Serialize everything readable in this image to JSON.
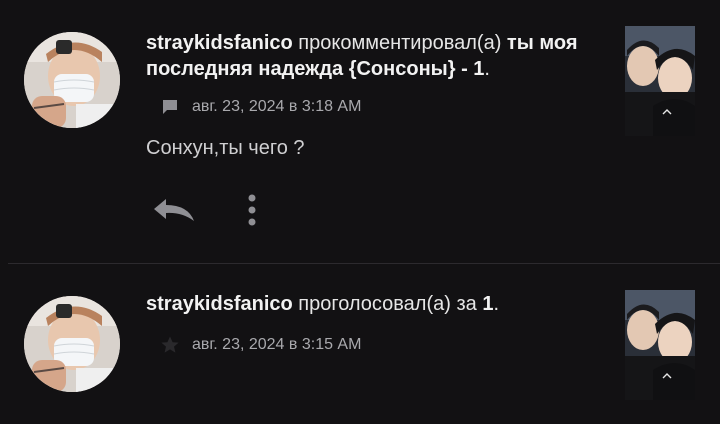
{
  "notifications": [
    {
      "user": "straykidsfanico",
      "action": "прокомментировал(а)",
      "target": "ты моя последняя надежда {Сонсоны} - 1",
      "target_suffix": ".",
      "timestamp": "авг. 23, 2024 в 3:18 AM",
      "meta_icon": "comment-icon",
      "comment": "Сонхун,ты чего ?",
      "actions": [
        {
          "name": "reply",
          "icon": "reply-icon"
        },
        {
          "name": "more",
          "icon": "more-vertical-icon"
        }
      ]
    },
    {
      "user": "straykidsfanico",
      "action": "проголосовал(а) за",
      "target": "1",
      "target_suffix": ".",
      "timestamp": "авг. 23, 2024 в 3:15 AM",
      "meta_icon": "star-icon"
    }
  ],
  "colors": {
    "background": "#121113",
    "text_primary": "#e6e6e6",
    "text_secondary": "#a9a9ad",
    "icon": "#8f8f94",
    "divider": "#2c2a2e"
  }
}
